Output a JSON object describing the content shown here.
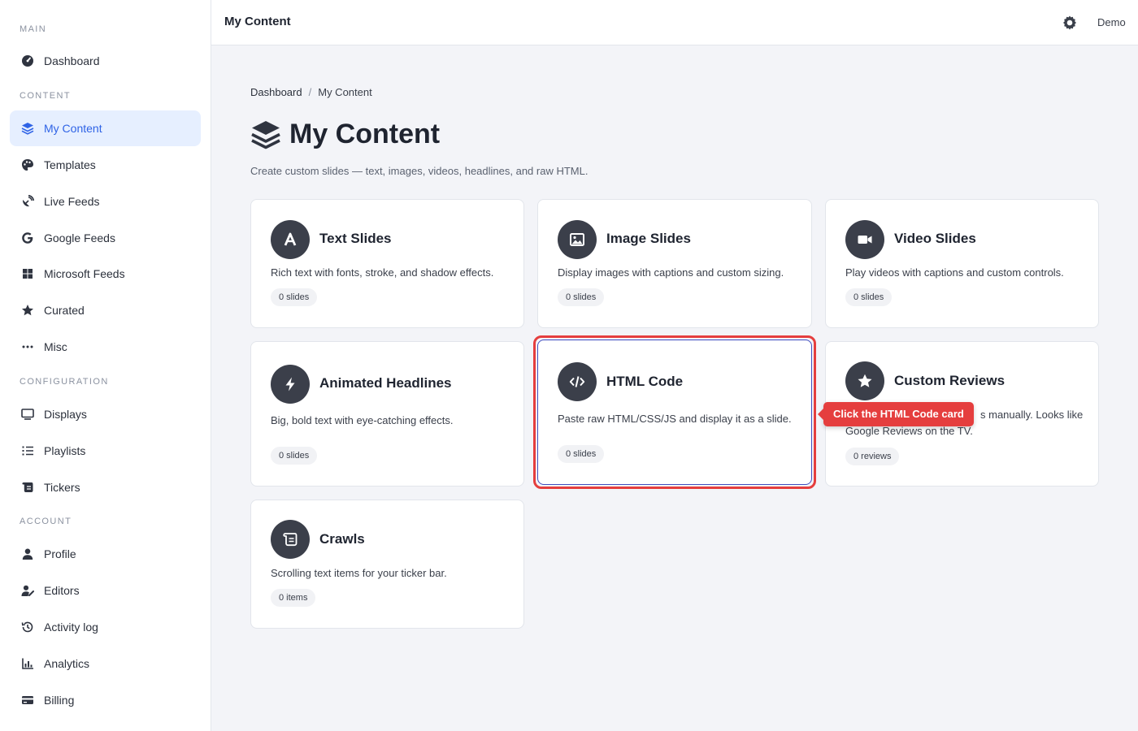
{
  "sidebar": {
    "sections": [
      "MAIN",
      "CONTENT",
      "CONFIGURATION",
      "ACCOUNT"
    ],
    "items": [
      {
        "label": "Dashboard",
        "icon": "gauge-icon"
      },
      {
        "label": "My Content",
        "icon": "layers-icon",
        "active": true
      },
      {
        "label": "Templates",
        "icon": "palette-icon"
      },
      {
        "label": "Live Feeds",
        "icon": "satellite-dish-icon"
      },
      {
        "label": "Google Feeds",
        "icon": "google-icon"
      },
      {
        "label": "Microsoft Feeds",
        "icon": "windows-icon"
      },
      {
        "label": "Curated",
        "icon": "star-icon"
      },
      {
        "label": "Misc",
        "icon": "ellipsis-icon"
      },
      {
        "label": "Displays",
        "icon": "monitor-icon"
      },
      {
        "label": "Playlists",
        "icon": "list-icon"
      },
      {
        "label": "Tickers",
        "icon": "scroll-icon"
      },
      {
        "label": "Profile",
        "icon": "user-icon"
      },
      {
        "label": "Editors",
        "icon": "user-pen-icon"
      },
      {
        "label": "Activity log",
        "icon": "history-icon"
      },
      {
        "label": "Analytics",
        "icon": "bar-chart-icon"
      },
      {
        "label": "Billing",
        "icon": "credit-card-icon"
      }
    ]
  },
  "topbar": {
    "title": "My Content",
    "user": "Demo",
    "settings_icon": "gear-icon"
  },
  "breadcrumb": {
    "home": "Dashboard",
    "sep": "/",
    "current": "My Content"
  },
  "page": {
    "title": "My Content",
    "subtitle": "Create custom slides — text, images, videos, headlines, and raw HTML."
  },
  "cards": [
    {
      "title": "Text Slides",
      "desc": "Rich text with fonts, stroke, and shadow effects.",
      "count": "0 slides",
      "icon": "letter-a-icon"
    },
    {
      "title": "Image Slides",
      "desc": "Display images with captions and custom sizing.",
      "count": "0 slides",
      "icon": "image-icon"
    },
    {
      "title": "Video Slides",
      "desc": "Play videos with captions and custom controls.",
      "count": "0 slides",
      "icon": "video-camera-icon"
    },
    {
      "title": "Animated Headlines",
      "desc": "Big, bold text with eye-catching effects.",
      "count": "0 slides",
      "icon": "bolt-icon"
    },
    {
      "title": "HTML Code",
      "desc": "Paste raw HTML/CSS/JS and display it as a slide.",
      "count": "0 slides",
      "icon": "code-icon"
    },
    {
      "title": "Custom Reviews",
      "desc_visible_end": "s manually. Looks like",
      "desc_line2": "Google Reviews on the TV.",
      "count": "0 reviews",
      "icon": "star-icon"
    },
    {
      "title": "Crawls",
      "desc": "Scrolling text items for your ticker bar.",
      "count": "0 items",
      "icon": "scroll-icon"
    }
  ],
  "tooltip": {
    "text": "Click the HTML Code card"
  }
}
